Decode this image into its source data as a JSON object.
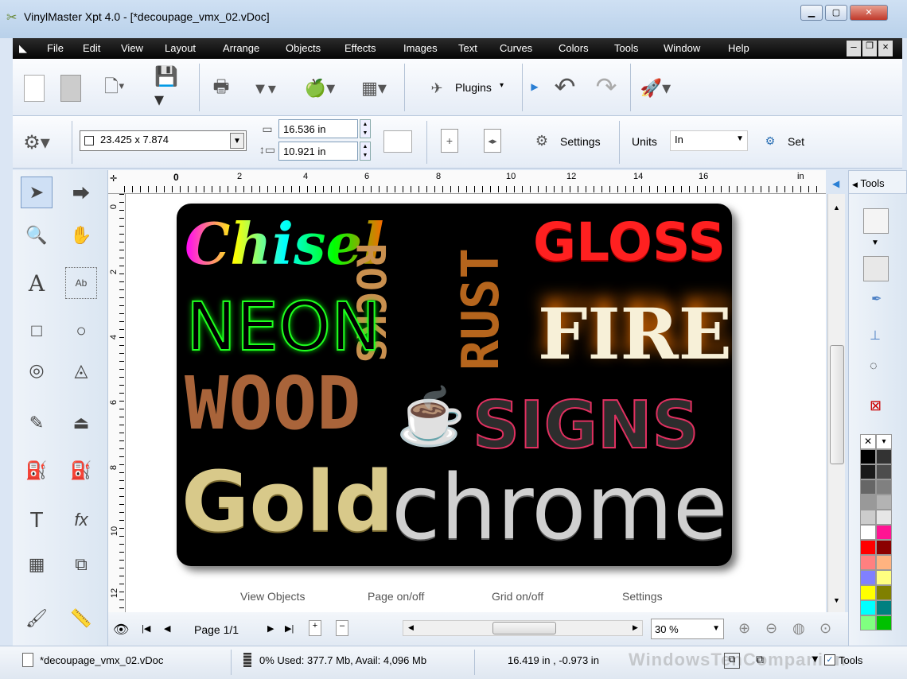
{
  "window": {
    "title": "VinylMaster Xpt 4.0 - [*decoupage_vmx_02.vDoc]"
  },
  "menu": [
    "File",
    "Edit",
    "View",
    "Layout",
    "Arrange",
    "Objects",
    "Effects",
    "Images",
    "Text",
    "Curves",
    "Colors",
    "Tools",
    "Window",
    "Help"
  ],
  "toolbar": {
    "plugins_label": "Plugins"
  },
  "propbar": {
    "doc_size": "23.425 x 7.874",
    "width": "16.536 in",
    "height": "10.921 in",
    "settings_label": "Settings",
    "units_label": "Units",
    "units_value": "In",
    "set_label": "Set"
  },
  "rulers": {
    "h_ticks": [
      "0",
      "2",
      "4",
      "6",
      "8",
      "10",
      "12",
      "14",
      "16",
      "in"
    ],
    "v_ticks": [
      "0",
      "2",
      "4",
      "6",
      "8",
      "10",
      "12"
    ]
  },
  "artwork": {
    "words": [
      "Chisel",
      "ROCKS",
      "RUST",
      "GLOSS",
      "NEON",
      "FIRE",
      "WOOD",
      "SIGNS",
      "Gold",
      "chrome"
    ]
  },
  "canvas_links": [
    "View Objects",
    "Page on/off",
    "Grid on/off",
    "Settings"
  ],
  "nav": {
    "page_label": "Page 1/1",
    "zoom": "30 %"
  },
  "right_panel": {
    "tools_tab": "Tools",
    "tools_header": "Tools"
  },
  "status": {
    "file": "*decoupage_vmx_02.vDoc",
    "memory": "0%  Used: 377.7 Mb, Avail: 4,096 Mb",
    "coords": "16.419 in , -0.973 in",
    "tools_check": "Tools",
    "watermark": "WindowsTenCompanion"
  },
  "colors": {
    "menubar": "#000000",
    "palette": [
      "#000000",
      "#333333",
      "#1a1a1a",
      "#4d4d4d",
      "#666666",
      "#808080",
      "#999999",
      "#b3b3b3",
      "#cccccc",
      "#e6e6e6",
      "#ffffff",
      "#ff1493",
      "#ff0000",
      "#8b0000",
      "#ff8080",
      "#ffb380",
      "#8080ff",
      "#ffff80",
      "#ffff00",
      "#808000",
      "#00ffff",
      "#008080",
      "#80ff80",
      "#00c000"
    ]
  }
}
